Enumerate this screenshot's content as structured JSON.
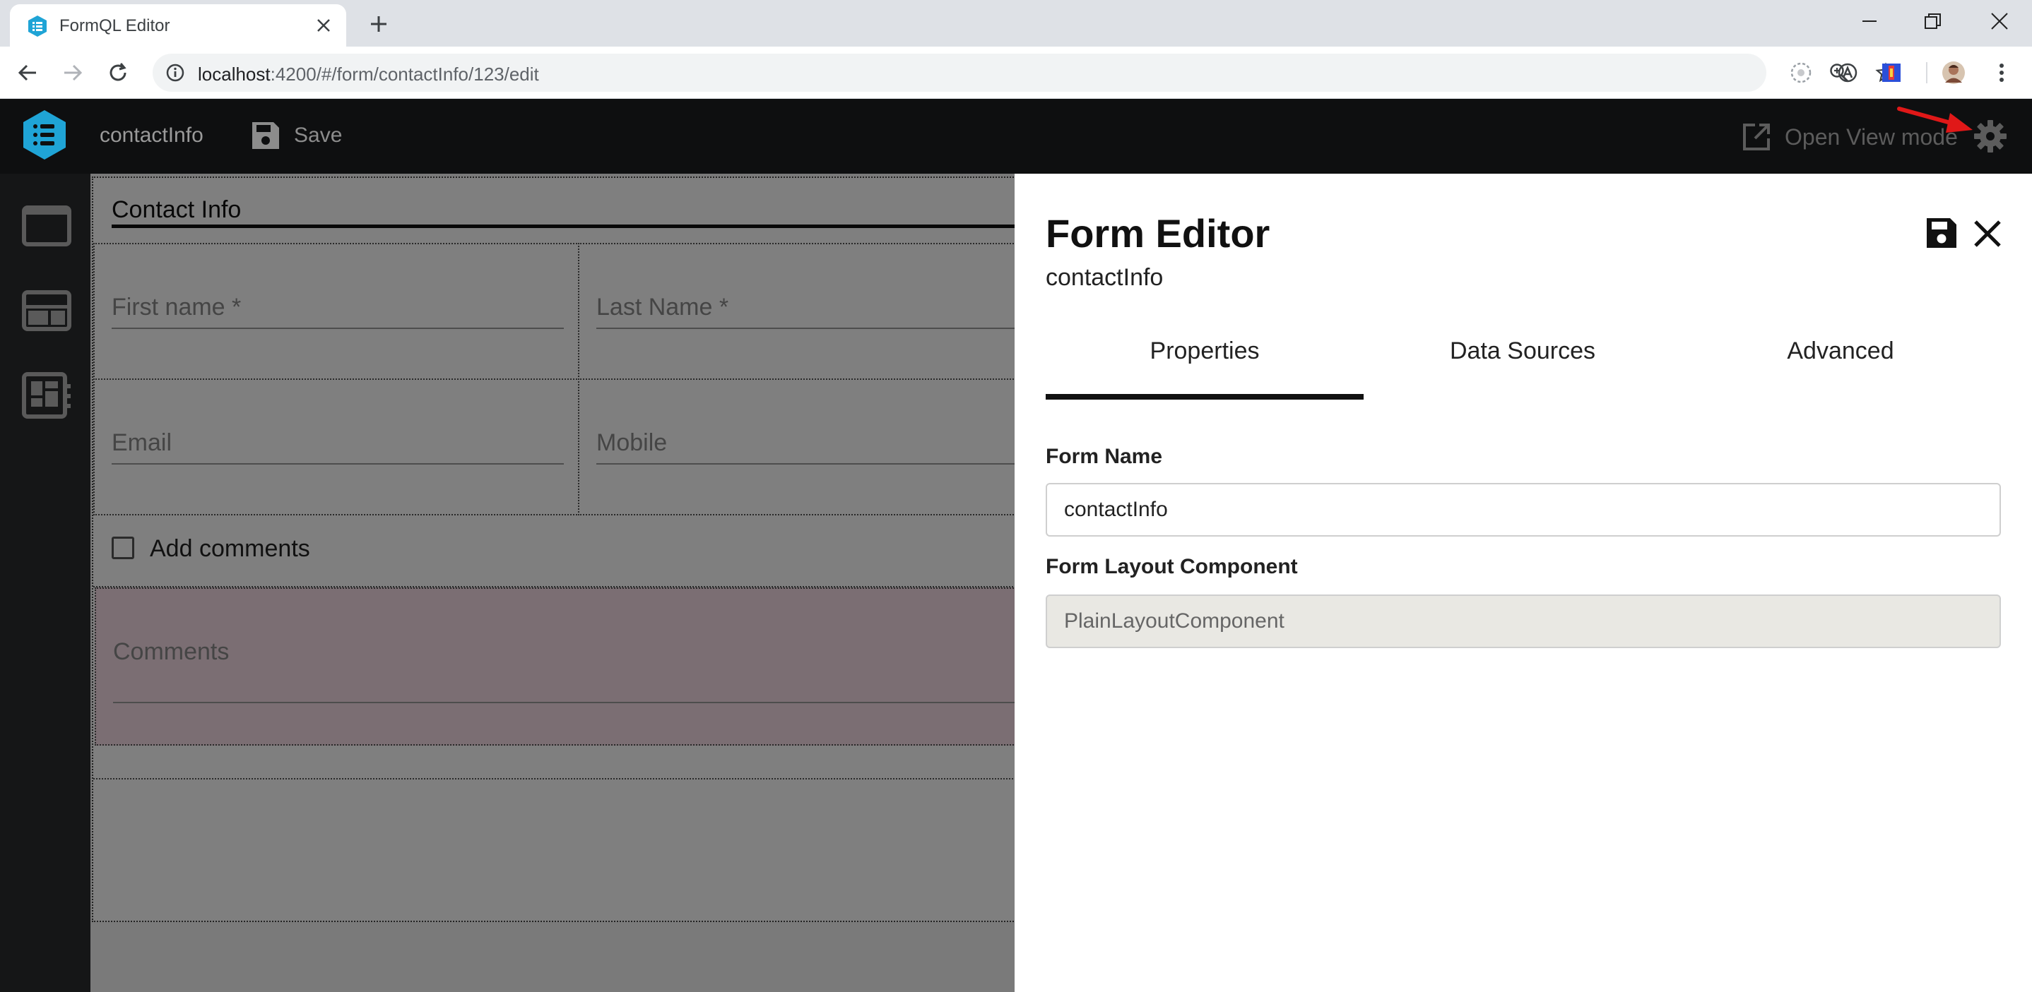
{
  "browser": {
    "tab_title": "FormQL Editor",
    "url_host": "localhost",
    "url_rest": ":4200/#/form/contactInfo/123/edit"
  },
  "app": {
    "form_name": "contactInfo",
    "save_label": "Save",
    "open_view_label": "Open View mode"
  },
  "canvas": {
    "section_title": "Contact Info",
    "fields": {
      "first_name": "First name *",
      "last_name": "Last Name *",
      "email": "Email",
      "mobile": "Mobile",
      "add_comments": "Add comments",
      "comments": "Comments"
    }
  },
  "drawer": {
    "title": "Form Editor",
    "subtitle": "contactInfo",
    "tabs": [
      "Properties",
      "Data Sources",
      "Advanced"
    ],
    "active_tab": "Properties",
    "form_name_label": "Form Name",
    "form_name_value": "contactInfo",
    "layout_label": "Form Layout Component",
    "layout_value": "PlainLayoutComponent"
  },
  "colors": {
    "header_bg": "#0e0f10",
    "accent_logo": "#1fa4d6",
    "annotation_arrow": "#e01818"
  }
}
